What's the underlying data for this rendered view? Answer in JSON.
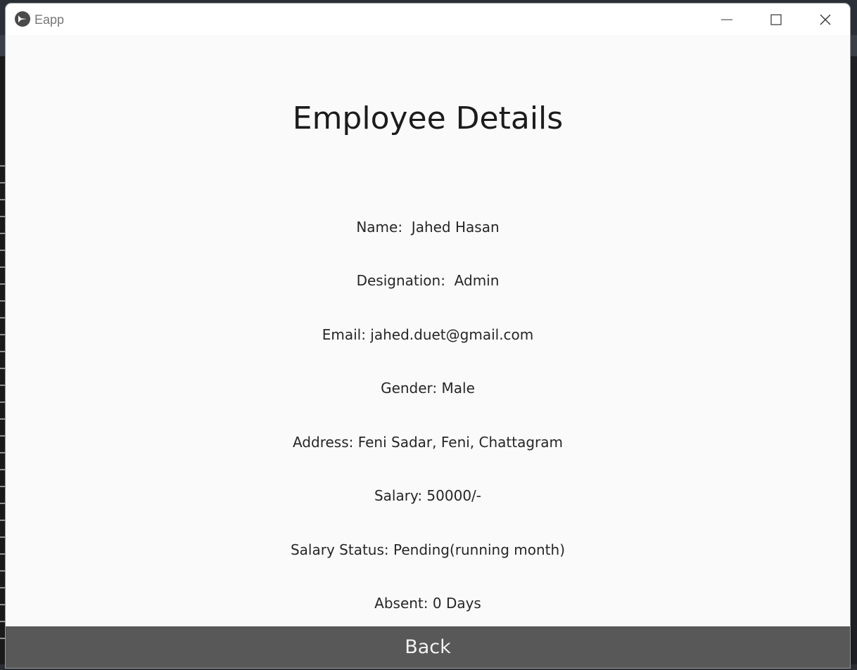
{
  "window": {
    "title": "Eapp",
    "app_icon": "kivy-logo-icon",
    "controls": [
      "minimize-icon",
      "maximize-icon",
      "close-icon"
    ]
  },
  "page": {
    "title": "Employee Details",
    "details": [
      {
        "label": "Name:  Jahed Hasan"
      },
      {
        "label": "Designation:  Admin"
      },
      {
        "label": "Email: jahed.duet@gmail.com"
      },
      {
        "label": "Gender: Male"
      },
      {
        "label": "Address: Feni Sadar, Feni, Chattagram"
      },
      {
        "label": "Salary: 50000/-"
      },
      {
        "label": "Salary Status: Pending(running month)"
      },
      {
        "label": "Absent: 0 Days"
      }
    ],
    "back_label": "Back"
  },
  "colors": {
    "window_bg": "#fafafa",
    "button_bg": "#585858",
    "button_text": "#f2f2f2",
    "text": "#262626"
  }
}
